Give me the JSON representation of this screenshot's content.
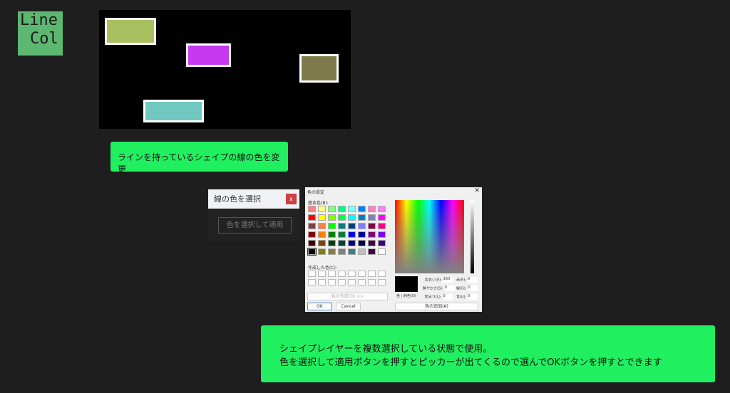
{
  "logo": {
    "line1": "Line",
    "line2": "Col"
  },
  "shapes": [
    {
      "color": "#a8c060"
    },
    {
      "color": "#c838f0"
    },
    {
      "color": "#7f7a4a"
    },
    {
      "color": "#70c8c0"
    }
  ],
  "note1": "ラインを持っているシェイプの線の色を変更",
  "note2": {
    "line1": "シェイプレイヤーを複数選択している状態で使用。",
    "line2": "色を選択して適用ボタンを押すとピッカーが出てくるので選んでOKボタンを押すとできます"
  },
  "panel": {
    "title": "線の色を選択",
    "close": "x",
    "apply": "色を選択して適用"
  },
  "dialog": {
    "title": "色の設定",
    "close": "✕",
    "basic_label": "基本色(B):",
    "custom_label": "作成した色(C):",
    "define": "色の作成(D) >>",
    "ok": "OK",
    "cancel": "Cancel",
    "solid": "色 | 純色(O)",
    "hue_label": "色合い(E):",
    "hue": "160",
    "sat_label": "鮮やかさ(S):",
    "sat": "0",
    "lum_label": "明るさ(L):",
    "lum": "0",
    "red_label": "赤(R):",
    "red": "0",
    "green_label": "緑(G):",
    "green": "0",
    "blue_label": "青(U):",
    "blue": "0",
    "add": "色の追加(A)",
    "palette": [
      "#FF8080",
      "#FFFF80",
      "#80FF80",
      "#00FF80",
      "#80FFFF",
      "#0080FF",
      "#FF80C0",
      "#FF80FF",
      "#FF0000",
      "#FFFF00",
      "#80FF00",
      "#00FF40",
      "#00FFFF",
      "#0080C0",
      "#8080C0",
      "#FF00FF",
      "#804040",
      "#FF8040",
      "#00FF00",
      "#008080",
      "#004080",
      "#8080FF",
      "#800040",
      "#FF0080",
      "#800000",
      "#FF8000",
      "#008000",
      "#008040",
      "#0000FF",
      "#0000A0",
      "#800080",
      "#8000FF",
      "#400000",
      "#804000",
      "#004000",
      "#004040",
      "#000080",
      "#000040",
      "#400040",
      "#400080",
      "#000000",
      "#808000",
      "#808040",
      "#808080",
      "#408080",
      "#C0C0C0",
      "#400040",
      "#FFFFFF"
    ]
  }
}
